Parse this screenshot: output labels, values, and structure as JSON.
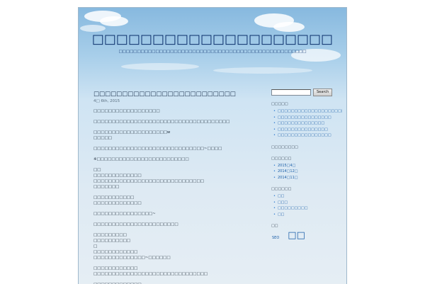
{
  "header": {
    "site_title": "□□□□□□□□□□□□□□□□□□□□",
    "site_description": "□□□□□□□□□□□□□□□□□□□□□□□□□□□□□□□□□□□□□□□□□□□□□□□□□□□"
  },
  "post": {
    "title": "□□□□□□□□□□□□□□□□□□□□□□□□□",
    "date": "4□ 6th, 2015",
    "paragraphs": [
      [
        "□□□□□□□□□□□□□□□□□□"
      ],
      [
        "□□□□□□□□□□□□□□□□□□□□□□□□□□□□□□□□□□□□□"
      ],
      [
        "□□□□□□□□□□□□□□□□□□□□w",
        "□□□□□"
      ],
      [
        "□□□□□□□□□□□□□□□□□□□□□□□□□□□□□□~□□□□"
      ],
      [
        "※□□□□□□□□□□□□□□□□□□□□□□□□□"
      ],
      [
        "□□",
        "□□□□□□□□□□□□□",
        "□□□□□□□□□□□□□□□□□□□□□□□□□□□□□□",
        "□□□□□□□"
      ],
      [
        "□□□□□□□□□□□",
        "□□□□□□□□□□□□□"
      ],
      [
        "□□□□□□□□□□□□□□□□~"
      ],
      [
        "□□□□□□□□□□□□□□□□□□□□□□□"
      ],
      [
        "□□□□□□□□□",
        "□□□□□□□□□□",
        "□",
        "□□□□□□□□□□□□",
        "□□□□□□□□□□□□□□~□□□□□□"
      ],
      [
        "□□□□□□□□□□□□",
        "□□□□□□□□□□□□□□□□□□□□□□□□□□□□□□□"
      ],
      [
        "□□□□□□□□□□□□□",
        "□□□□□□□□□□□□□□□"
      ]
    ]
  },
  "sidebar": {
    "search": {
      "placeholder": "",
      "value": "",
      "button_label": "Search"
    },
    "recent_posts": {
      "title": "□□□□□",
      "items": [
        "□□□□□□□□□□□□□□□□□□□□□□□□□",
        "□□□□□□□□□□□□□□□□",
        "□□□□□□□□□□□□□□",
        "□□□□□□□□□□□□□□□",
        "□□□□□□□□□□□□□□□□"
      ]
    },
    "recent_comments": {
      "title": "□□□□□□□□"
    },
    "archives": {
      "title": "□□□□□□",
      "items": [
        "2015□4□",
        "2014□12□",
        "2014□11□"
      ]
    },
    "categories": {
      "title": "□□□□□□",
      "items": [
        "□□",
        "□□□",
        "□□□□□□□□□",
        "□□"
      ]
    },
    "tags": {
      "title": "□□",
      "small_tag": "SEO",
      "big_tag": "□□"
    }
  },
  "colors": {
    "title": "#0b2f6b",
    "link": "#1a5ea8",
    "sky_top": "#87b9df",
    "page_bottom": "#e6eef4"
  }
}
